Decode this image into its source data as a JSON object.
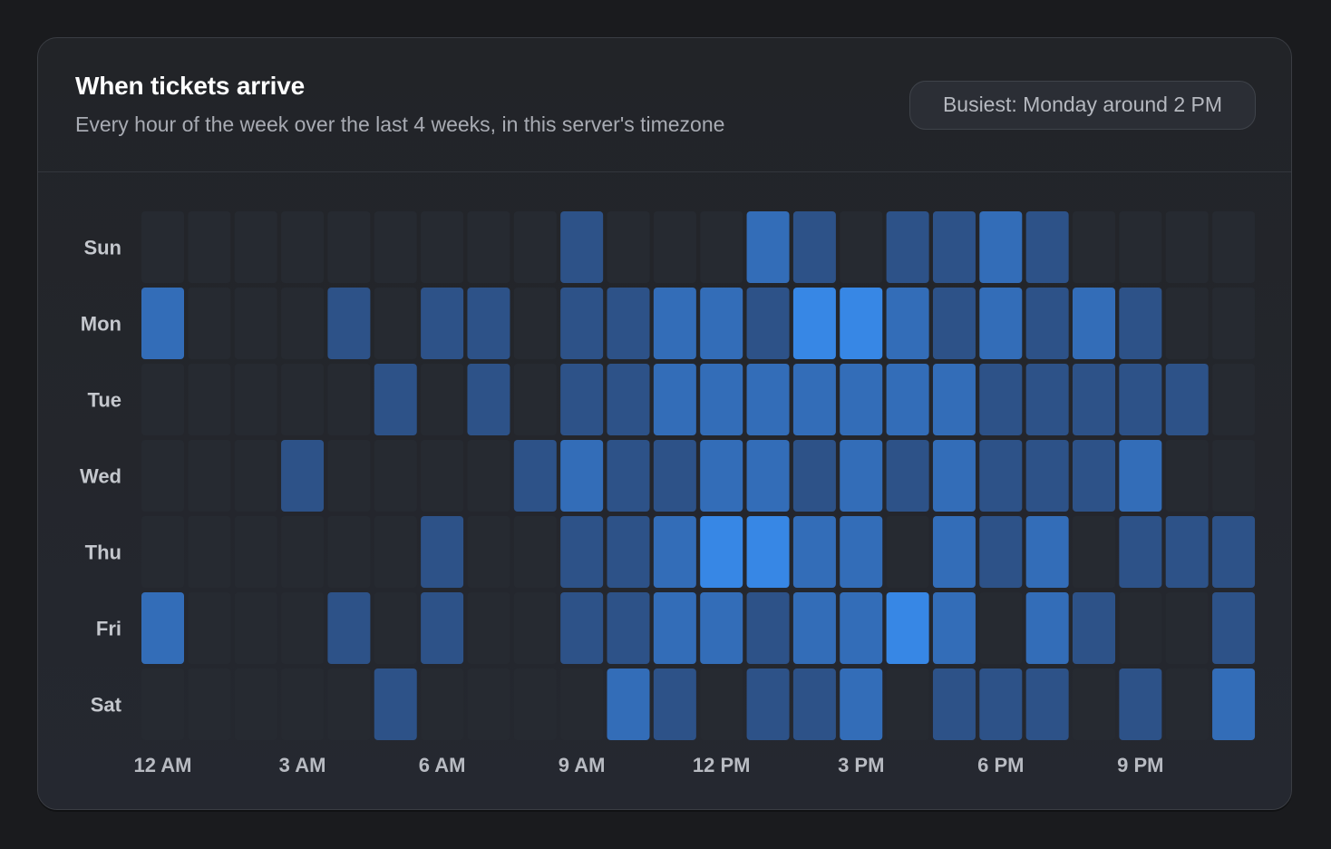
{
  "card": {
    "title": "When tickets arrive",
    "subtitle": "Every hour of the week over the last 4 weeks, in this server's timezone",
    "busiest_label": "Busiest: Monday around 2 PM"
  },
  "colors": {
    "background": "#1a1b1e",
    "card": "#23252a",
    "empty_cell": "#262a31",
    "level_1": "#2d5288",
    "level_2": "#336db8",
    "level_3": "#3787e5"
  },
  "chart_data": {
    "type": "heatmap",
    "title": "When tickets arrive",
    "rows": [
      "Sun",
      "Mon",
      "Tue",
      "Wed",
      "Thu",
      "Fri",
      "Sat"
    ],
    "columns": [
      "12 AM",
      "1 AM",
      "2 AM",
      "3 AM",
      "4 AM",
      "5 AM",
      "6 AM",
      "7 AM",
      "8 AM",
      "9 AM",
      "10 AM",
      "11 AM",
      "12 PM",
      "1 PM",
      "2 PM",
      "3 PM",
      "4 PM",
      "5 PM",
      "6 PM",
      "7 PM",
      "8 PM",
      "9 PM",
      "10 PM",
      "11 PM"
    ],
    "x_tick_labels": [
      "12 AM",
      "3 AM",
      "6 AM",
      "9 AM",
      "12 PM",
      "3 PM",
      "6 PM",
      "9 PM"
    ],
    "x_tick_every": 3,
    "value_scale": "relative intensity levels 0-3",
    "values": [
      [
        0,
        0,
        0,
        0,
        0,
        0,
        0,
        0,
        0,
        1,
        0,
        0,
        0,
        2,
        1,
        0,
        1,
        1,
        1.5,
        1,
        0,
        0,
        0,
        0
      ],
      [
        1.5,
        0,
        0,
        0,
        1,
        0,
        1,
        1,
        0,
        1,
        1,
        1.5,
        2,
        1,
        3,
        3,
        2,
        1,
        2,
        1,
        2,
        1,
        0,
        0
      ],
      [
        0,
        0,
        0,
        0,
        0,
        1,
        0,
        1,
        0,
        1,
        1,
        2,
        2,
        2,
        2,
        2,
        2,
        2,
        1,
        1,
        1,
        1,
        1,
        0
      ],
      [
        0,
        0,
        0,
        1,
        0,
        0,
        0,
        0,
        1,
        2,
        1,
        1,
        2,
        2,
        1,
        2,
        1,
        2,
        1,
        1,
        1,
        2,
        0,
        0
      ],
      [
        0,
        0,
        0,
        0,
        0,
        0,
        1,
        0,
        0,
        1,
        1,
        1.5,
        3,
        3,
        2,
        2,
        0,
        1.5,
        1,
        1.5,
        0,
        1,
        1,
        1
      ],
      [
        1.5,
        0,
        0,
        0,
        1,
        0,
        1,
        0,
        0,
        1,
        1,
        2,
        2,
        1,
        1.5,
        2,
        3,
        2,
        0,
        2,
        1,
        0,
        0,
        1
      ],
      [
        0,
        0,
        0,
        0,
        0,
        1,
        0,
        0,
        0,
        0,
        1.5,
        1,
        0,
        1,
        1,
        1.5,
        0,
        1,
        1,
        1,
        0,
        1,
        0,
        1.5
      ]
    ]
  }
}
